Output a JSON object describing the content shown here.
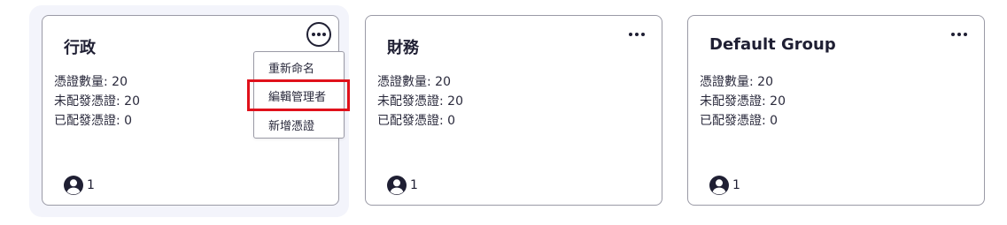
{
  "cards": [
    {
      "title": "行政",
      "stats": [
        "憑證數量: 20",
        "未配發憑證: 20",
        "已配發憑證: 0"
      ],
      "user_count": "1",
      "menu_open": true
    },
    {
      "title": "財務",
      "stats": [
        "憑證數量: 20",
        "未配發憑證: 20",
        "已配發憑證: 0"
      ],
      "user_count": "1",
      "menu_open": false
    },
    {
      "title": "Default Group",
      "stats": [
        "憑證數量: 20",
        "未配發憑證: 20",
        "已配發憑證: 0"
      ],
      "user_count": "1",
      "menu_open": false
    }
  ],
  "context_menu": {
    "items": [
      "重新命名",
      "編輯管理者",
      "新增憑證"
    ],
    "highlighted_item": "編輯管理者"
  },
  "colors": {
    "highlight": "#e0111b",
    "card_border": "#9a9aa6",
    "active_halo": "#f3f4fb",
    "text": "#1f1f33"
  },
  "icons": {
    "more": "more-horizontal-icon",
    "user": "user-circle-icon"
  }
}
